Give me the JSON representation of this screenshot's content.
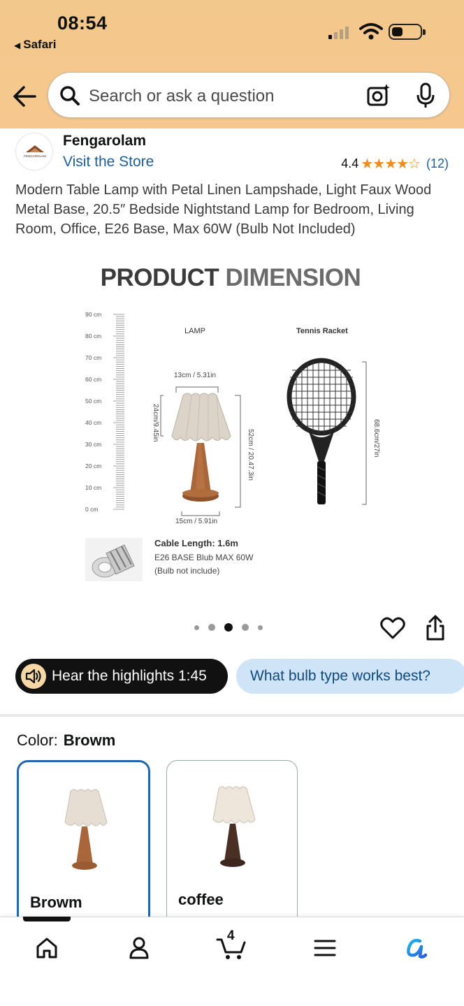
{
  "status_bar": {
    "time": "08:54",
    "back_app": "Safari"
  },
  "search": {
    "placeholder": "Search or ask a question"
  },
  "brand": {
    "name": "Fengarolam",
    "store_link": "Visit the Store",
    "logo_text": "FENGAROLAM"
  },
  "rating": {
    "value": "4.4",
    "stars": "★★★★☆",
    "count": "(12)"
  },
  "product": {
    "title": "Modern Table Lamp with Petal Linen Lampshade, Light Faux Wood Metal Base, 20.5″ Bedside Nightstand Lamp for Bedroom, Living Room, Office, E26 Base, Max 60W (Bulb Not Included)"
  },
  "image": {
    "heading_dark": "PRODUCT",
    "heading_light": "DIMENSION",
    "scale_labels": [
      "90 cm",
      "80 cm",
      "70 cm",
      "60 cm",
      "50 cm",
      "40 cm",
      "30 cm",
      "20 cm",
      "10 cm",
      "0 cm"
    ],
    "lamp_label": "LAMP",
    "racket_label": "Tennis Racket",
    "shade_width": "13cm / 5.31in",
    "shade_height": "24cm/9.45in",
    "lamp_height": "52cm / 20.47.3in",
    "base_width": "15cm / 5.91in",
    "racket_length": "68.6cm/27in",
    "cable_title": "Cable Length: 1.6m",
    "cable_line1": "E26 BASE Blub MAX 60W",
    "cable_line2": "(Bulb not include)"
  },
  "carousel": {
    "active_index": 2,
    "total": 5
  },
  "pills": {
    "audio": "Hear the highlights 1:45",
    "question": "What bulb type works best?"
  },
  "color": {
    "label": "Color:",
    "selected": "Browm"
  },
  "swatches": [
    {
      "name": "Browm",
      "selected": true,
      "base_color": "#a8663a"
    },
    {
      "name": "coffee",
      "selected": false,
      "base_color": "#4a2f25"
    }
  ],
  "bottom_nav": {
    "cart_count": "4",
    "items": [
      "home",
      "account",
      "cart",
      "menu",
      "rufus"
    ]
  },
  "colors": {
    "header_bg": "#f3c88c",
    "link": "#1d5f9a",
    "star": "#f08b1d",
    "selected_border": "#2466a8"
  }
}
